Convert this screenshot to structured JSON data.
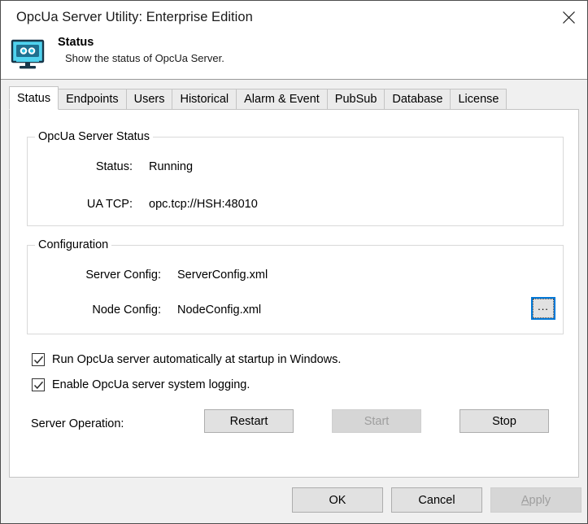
{
  "window": {
    "title": "OpcUa Server Utility: Enterprise Edition",
    "close_icon": "close-icon"
  },
  "header": {
    "icon": "monitor-robot-icon",
    "title": "Status",
    "subtitle": "Show the status of OpcUa Server."
  },
  "tabs": [
    {
      "label": "Status",
      "selected": true
    },
    {
      "label": "Endpoints",
      "selected": false
    },
    {
      "label": "Users",
      "selected": false
    },
    {
      "label": "Historical",
      "selected": false
    },
    {
      "label": "Alarm & Event",
      "selected": false
    },
    {
      "label": "PubSub",
      "selected": false
    },
    {
      "label": "Database",
      "selected": false
    },
    {
      "label": "License",
      "selected": false
    }
  ],
  "status_group": {
    "legend": "OpcUa Server Status",
    "rows": [
      {
        "label": "Status:",
        "value": "Running"
      },
      {
        "label": "UA TCP:",
        "value": "opc.tcp://HSH:48010"
      }
    ]
  },
  "configuration_group": {
    "legend": "Configuration",
    "rows": [
      {
        "label": "Server Config:",
        "value": "ServerConfig.xml"
      },
      {
        "label": "Node Config:",
        "value": "NodeConfig.xml"
      }
    ],
    "browse_button": {
      "label": "...",
      "focused": true
    }
  },
  "checkboxes": [
    {
      "label": "Run OpcUa server automatically at startup in Windows.",
      "checked": true
    },
    {
      "label": "Enable OpcUa server system logging.",
      "checked": true
    }
  ],
  "server_operation": {
    "label": "Server Operation:",
    "buttons": [
      {
        "label": "Restart",
        "disabled": false
      },
      {
        "label": "Start",
        "disabled": true
      },
      {
        "label": "Stop",
        "disabled": false
      }
    ]
  },
  "footer": {
    "buttons": [
      {
        "label": "OK",
        "disabled": false,
        "accel": ""
      },
      {
        "label": "Cancel",
        "disabled": false,
        "accel": ""
      },
      {
        "label": "Apply",
        "disabled": true,
        "accel": "A"
      }
    ]
  },
  "colors": {
    "focus_blue": "#0078d7",
    "icon_cyan": "#4fd2ee",
    "icon_outline": "#17374a",
    "panel_bg": "#f0f0f0",
    "button_face": "#e1e1e1"
  }
}
